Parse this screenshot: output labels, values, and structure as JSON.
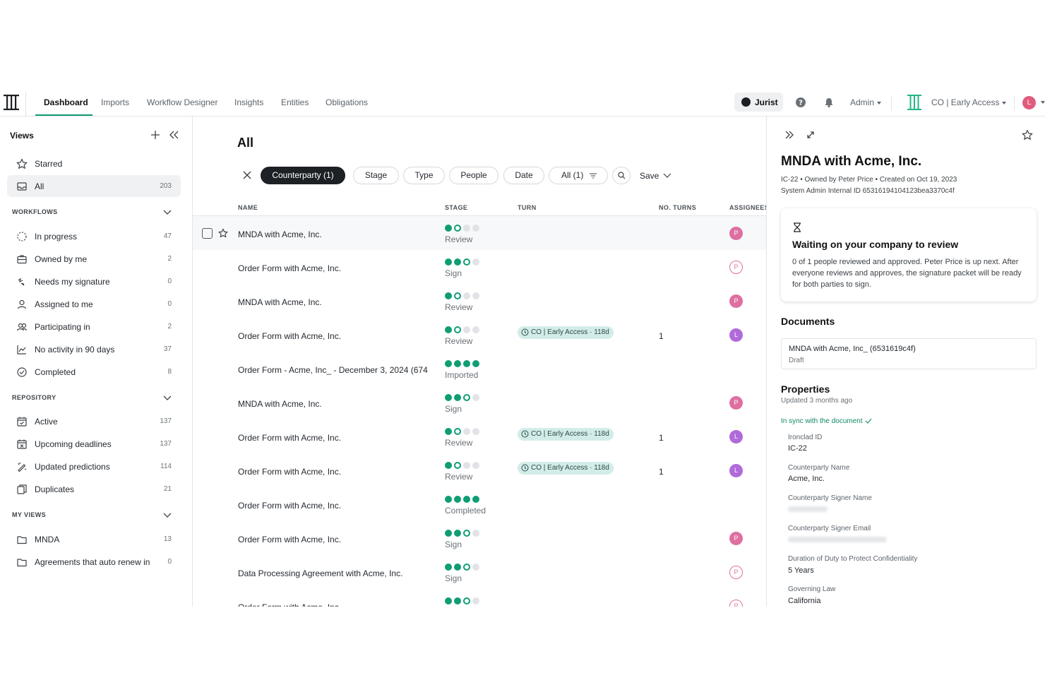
{
  "nav": {
    "tabs": [
      {
        "label": "Dashboard",
        "active": true
      },
      {
        "label": "Imports"
      },
      {
        "label": "Workflow Designer"
      },
      {
        "label": "Insights"
      },
      {
        "label": "Entities"
      },
      {
        "label": "Obligations"
      }
    ],
    "jurist": "Jurist",
    "admin": "Admin",
    "org": "CO | Early Access",
    "user_initial": "L",
    "icons": [
      "app-logo",
      "help-icon",
      "bell-icon",
      "org-logo"
    ]
  },
  "sidebar": {
    "title": "Views",
    "top_items": [
      {
        "label": "Starred",
        "count": "",
        "icon": "star-icon"
      },
      {
        "label": "All",
        "count": "203",
        "icon": "inbox-icon",
        "active": true
      }
    ],
    "sections": [
      {
        "title": "WORKFLOWS",
        "items": [
          {
            "label": "In progress",
            "count": "47",
            "icon": "progress-icon"
          },
          {
            "label": "Owned by me",
            "count": "2",
            "icon": "briefcase-icon"
          },
          {
            "label": "Needs my signature",
            "count": "0",
            "icon": "signature-icon"
          },
          {
            "label": "Assigned to me",
            "count": "0",
            "icon": "person-icon"
          },
          {
            "label": "Participating in",
            "count": "2",
            "icon": "people-icon"
          },
          {
            "label": "No activity in 90 days",
            "count": "37",
            "icon": "chart-line-icon"
          },
          {
            "label": "Completed",
            "count": "8",
            "icon": "check-circle-icon"
          }
        ]
      },
      {
        "title": "REPOSITORY",
        "items": [
          {
            "label": "Active",
            "count": "137",
            "icon": "calendar-check-icon"
          },
          {
            "label": "Upcoming deadlines",
            "count": "137",
            "icon": "calendar-x-icon"
          },
          {
            "label": "Updated predictions",
            "count": "114",
            "icon": "sparkle-edit-icon"
          },
          {
            "label": "Duplicates",
            "count": "21",
            "icon": "duplicate-icon"
          }
        ]
      },
      {
        "title": "MY VIEWS",
        "items": [
          {
            "label": "MNDA",
            "count": "13",
            "icon": "folder-icon"
          },
          {
            "label": "Agreements that auto renew in",
            "count": "0",
            "icon": "folder-icon"
          }
        ]
      }
    ]
  },
  "main": {
    "title": "All",
    "filters": [
      {
        "label": "Counterparty (1)",
        "selected": true
      },
      {
        "label": "Stage"
      },
      {
        "label": "Type"
      },
      {
        "label": "People"
      },
      {
        "label": "Date"
      },
      {
        "label": "All (1)"
      }
    ],
    "save_label": "Save",
    "columns": [
      "NAME",
      "STAGE",
      "TURN",
      "NO. TURNS",
      "ASSIGNEES"
    ],
    "rows": [
      {
        "name": "MNDA with Acme, Inc.",
        "dots": [
          "f",
          "o",
          "e",
          "e"
        ],
        "stage": "Review",
        "turn": "",
        "turns": "",
        "assignee": "P",
        "assignee_style": "p",
        "hover": true
      },
      {
        "name": "Order Form with Acme, Inc.",
        "dots": [
          "f",
          "f",
          "o",
          "e"
        ],
        "stage": "Sign",
        "turn": "",
        "turns": "",
        "assignee": "P",
        "assignee_style": "po"
      },
      {
        "name": "MNDA with Acme, Inc.",
        "dots": [
          "f",
          "o",
          "e",
          "e"
        ],
        "stage": "Review",
        "turn": "",
        "turns": "",
        "assignee": "P",
        "assignee_style": "p"
      },
      {
        "name": "Order Form with Acme, Inc.",
        "dots": [
          "f",
          "o",
          "e",
          "e"
        ],
        "stage": "Review",
        "turn": "CO | Early Access · 118d",
        "turns": "1",
        "assignee": "L",
        "assignee_style": "l"
      },
      {
        "name": "Order Form - Acme, Inc_ - December 3, 2024 (674",
        "dots": [
          "f",
          "f",
          "f",
          "f"
        ],
        "stage": "Imported",
        "turn": "",
        "turns": "",
        "assignee": "",
        "assignee_style": ""
      },
      {
        "name": "MNDA with Acme, Inc.",
        "dots": [
          "f",
          "f",
          "o",
          "e"
        ],
        "stage": "Sign",
        "turn": "",
        "turns": "",
        "assignee": "P",
        "assignee_style": "p"
      },
      {
        "name": "Order Form with Acme, Inc.",
        "dots": [
          "f",
          "o",
          "e",
          "e"
        ],
        "stage": "Review",
        "turn": "CO | Early Access · 118d",
        "turns": "1",
        "assignee": "L",
        "assignee_style": "l"
      },
      {
        "name": "Order Form with Acme, Inc.",
        "dots": [
          "f",
          "o",
          "e",
          "e"
        ],
        "stage": "Review",
        "turn": "CO | Early Access · 118d",
        "turns": "1",
        "assignee": "L",
        "assignee_style": "l"
      },
      {
        "name": "Order Form with Acme, Inc.",
        "dots": [
          "f",
          "f",
          "f",
          "f"
        ],
        "stage": "Completed",
        "turn": "",
        "turns": "",
        "assignee": "",
        "assignee_style": ""
      },
      {
        "name": "Order Form with Acme, Inc.",
        "dots": [
          "f",
          "f",
          "o",
          "e"
        ],
        "stage": "Sign",
        "turn": "",
        "turns": "",
        "assignee": "P",
        "assignee_style": "p"
      },
      {
        "name": "Data Processing Agreement with Acme, Inc.",
        "dots": [
          "f",
          "f",
          "o",
          "e"
        ],
        "stage": "Sign",
        "turn": "",
        "turns": "",
        "assignee": "P",
        "assignee_style": "po"
      },
      {
        "name": "Order Form with Acme, Inc.",
        "dots": [
          "f",
          "f",
          "o",
          "e"
        ],
        "stage": "",
        "turn": "",
        "turns": "",
        "assignee": "P",
        "assignee_style": "po"
      }
    ]
  },
  "panel": {
    "title": "MNDA with Acme, Inc.",
    "meta": "IC-22  •  Owned by Peter Price  •  Created on Oct 19, 2023",
    "internal_id": "System Admin Internal ID 65316194104123bea3370c4f",
    "wait_title": "Waiting on your company to review",
    "wait_desc": "0 of 1 people reviewed and approved. Peter Price is up next. After everyone reviews and approves, the signature packet will be ready for both parties to sign.",
    "documents_title": "Documents",
    "doc_name": "MNDA with Acme, Inc_ (6531619c4f)",
    "doc_status": "Draft",
    "properties_title": "Properties",
    "properties_updated": "Updated 3 months ago",
    "sync": "In sync with the document",
    "properties": [
      {
        "label": "Ironclad ID",
        "value": "IC-22"
      },
      {
        "label": "Counterparty Name",
        "value": "Acme, Inc."
      },
      {
        "label": "Counterparty Signer Name",
        "value": ""
      },
      {
        "label": "Counterparty Signer Email",
        "value": ""
      },
      {
        "label": "Duration of Duty to Protect Confidentiality",
        "value": "5 Years"
      },
      {
        "label": "Governing Law",
        "value": "California"
      }
    ]
  },
  "colors": {
    "accent": "#0f9d74",
    "turn_chip": "#d2ede9",
    "avatar_p": "#de6fa1",
    "avatar_l": "#b06ad9"
  }
}
